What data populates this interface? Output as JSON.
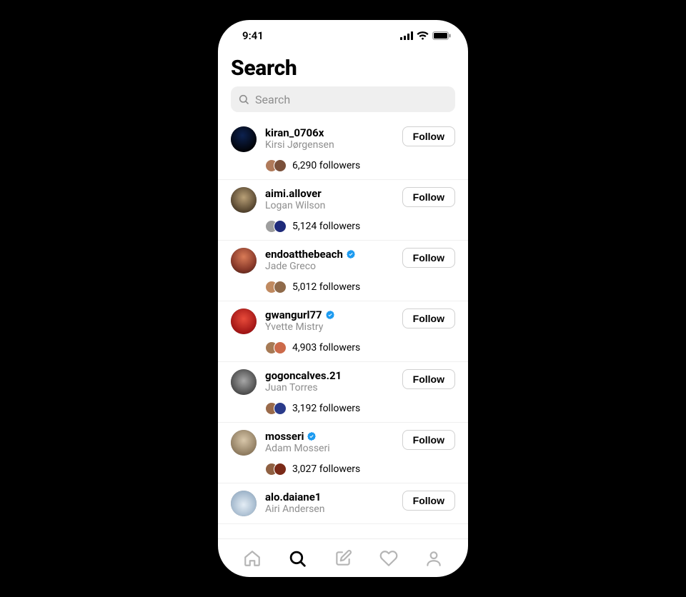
{
  "status": {
    "time": "9:41"
  },
  "page": {
    "title": "Search"
  },
  "search": {
    "placeholder": "Search"
  },
  "follow_label": "Follow",
  "users": [
    {
      "username": "kiran_0706x",
      "display_name": "Kirsi Jørgensen",
      "verified": false,
      "followers_text": "6,290 followers",
      "avatar": {
        "bg": "#111122",
        "shape": "radial-gradient(circle at 45% 35%, #0d2250 0%, #02040a 70%)"
      },
      "pile": [
        "#b07a5a",
        "#7a503a"
      ]
    },
    {
      "username": "aimi.allover",
      "display_name": "Logan Wilson",
      "verified": false,
      "followers_text": "5,124 followers",
      "avatar": {
        "bg": "#6b6b6b",
        "shape": "radial-gradient(circle at 50% 40%, #b9a077 0%, #5b4a33 65%, #2e2619 100%)"
      },
      "pile": [
        "#9e9e9e",
        "#1e2a7a"
      ]
    },
    {
      "username": "endoatthebeach",
      "display_name": "Jade Greco",
      "verified": true,
      "followers_text": "5,012 followers",
      "avatar": {
        "bg": "#8a3a2a",
        "shape": "radial-gradient(circle at 50% 35%, #d97b57 0%, #8a3a2a 60%, #3e1a12 100%)"
      },
      "pile": [
        "#c08a60",
        "#8f6a4a"
      ]
    },
    {
      "username": "gwangurl77",
      "display_name": "Yvette Mistry",
      "verified": true,
      "followers_text": "4,903 followers",
      "avatar": {
        "bg": "#c21f1f",
        "shape": "radial-gradient(circle at 50% 40%, #e84b3a 0%, #a11515 70%)"
      },
      "pile": [
        "#a67a55",
        "#cc6a4a"
      ]
    },
    {
      "username": "gogoncalves.21",
      "display_name": "Juan Torres",
      "verified": false,
      "followers_text": "3,192 followers",
      "avatar": {
        "bg": "#737373",
        "shape": "radial-gradient(circle at 50% 45%, #a7a7a7 0%, #4a4a4a 72%)"
      },
      "pile": [
        "#9a6a4a",
        "#2a3a8a"
      ]
    },
    {
      "username": "mosseri",
      "display_name": "Adam Mosseri",
      "verified": true,
      "followers_text": "3,027 followers",
      "avatar": {
        "bg": "#b8a48a",
        "shape": "radial-gradient(circle at 50% 40%, #d8c7aa 0%, #8f7c60 70%)"
      },
      "pile": [
        "#8f6042",
        "#7a2a18"
      ]
    },
    {
      "username": "alo.daiane1",
      "display_name": "Airi Andersen",
      "verified": false,
      "followers_text": "",
      "avatar": {
        "bg": "#b9c9d9",
        "shape": "radial-gradient(circle at 50% 55%, #e4edf5 0%, #9fb5ca 70%)"
      },
      "pile": []
    }
  ],
  "tabs": {
    "home": false,
    "search": true,
    "compose": false,
    "activity": false,
    "profile": false
  }
}
